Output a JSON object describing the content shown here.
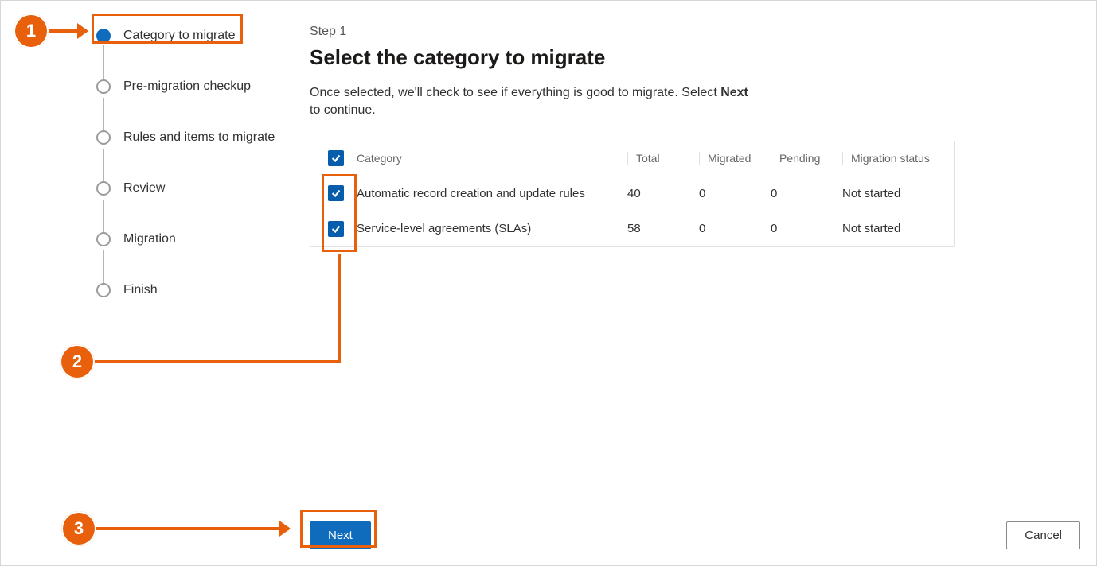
{
  "stepper": {
    "steps": [
      {
        "label": "Category to migrate",
        "current": true
      },
      {
        "label": "Pre-migration checkup",
        "current": false
      },
      {
        "label": "Rules and items to migrate",
        "current": false
      },
      {
        "label": "Review",
        "current": false
      },
      {
        "label": "Migration",
        "current": false
      },
      {
        "label": "Finish",
        "current": false
      }
    ]
  },
  "main": {
    "step_label": "Step 1",
    "title": "Select the category to migrate",
    "desc_pre": "Once selected, we'll check to see if everything is good to migrate. Select ",
    "desc_bold": "Next",
    "desc_post": " to continue."
  },
  "grid": {
    "headers": {
      "category": "Category",
      "total": "Total",
      "migrated": "Migrated",
      "pending": "Pending",
      "status": "Migration status"
    },
    "rows": [
      {
        "checked": true,
        "category": "Automatic record creation and update rules",
        "total": "40",
        "migrated": "0",
        "pending": "0",
        "status": "Not started"
      },
      {
        "checked": true,
        "category": "Service-level agreements (SLAs)",
        "total": "58",
        "migrated": "0",
        "pending": "0",
        "status": "Not started"
      }
    ]
  },
  "footer": {
    "next": "Next",
    "cancel": "Cancel"
  },
  "annotations": {
    "b1": "1",
    "b2": "2",
    "b3": "3"
  }
}
